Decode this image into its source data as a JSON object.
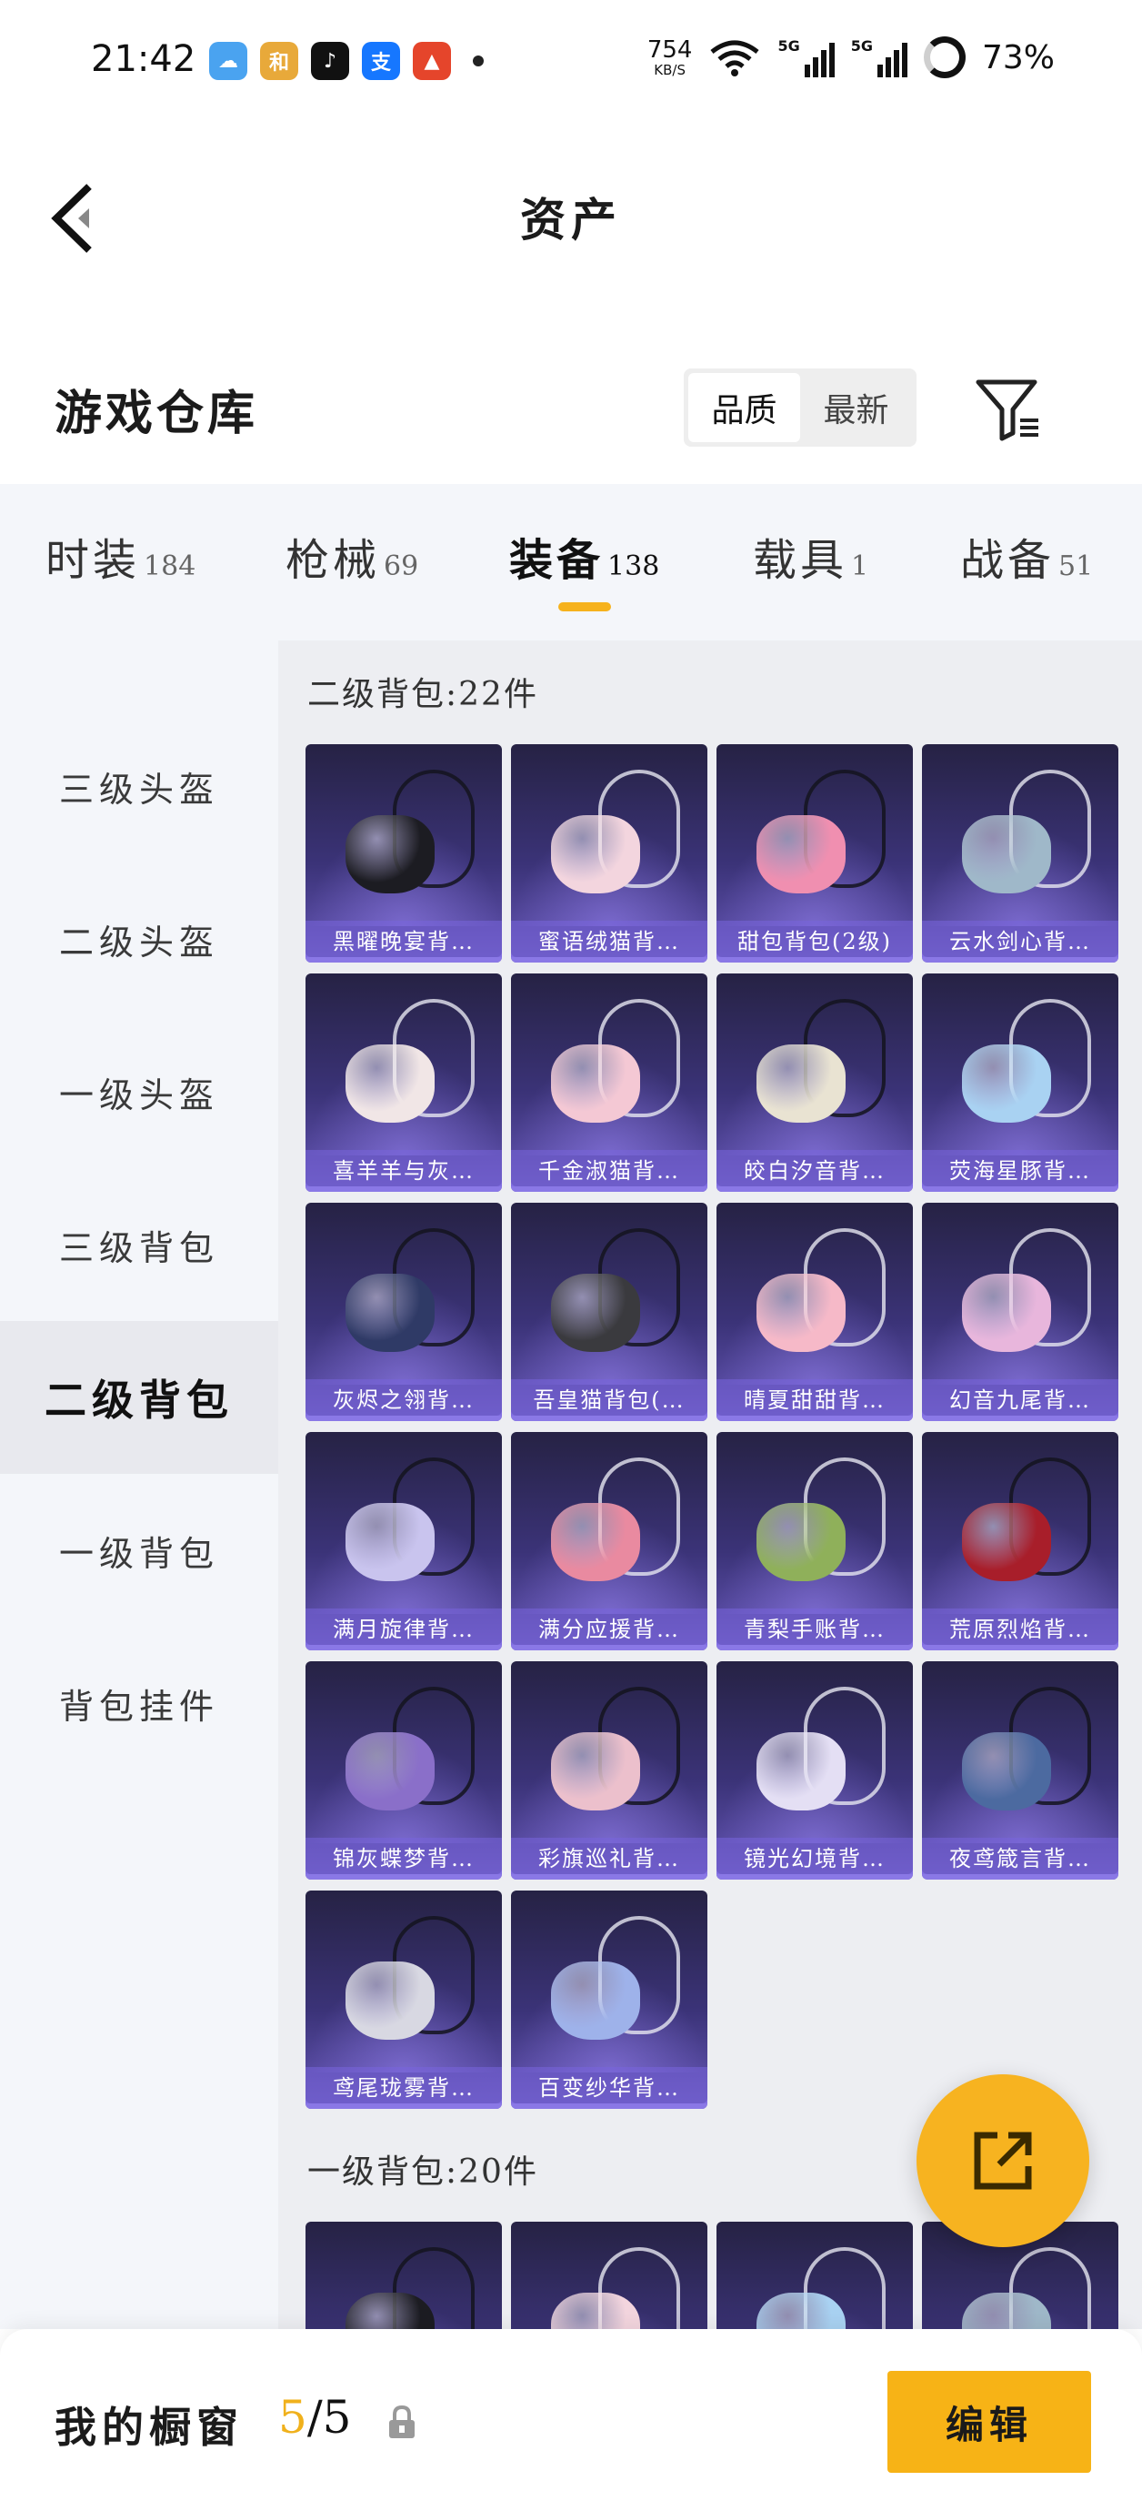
{
  "status_bar": {
    "time": "21:42",
    "apps": [
      {
        "icon": "weather-app-icon",
        "glyph": "☁",
        "color": "#4aa3f0"
      },
      {
        "icon": "game-app-icon",
        "glyph": "和",
        "color": "#e8a93a"
      },
      {
        "icon": "tiktok-app-icon",
        "glyph": "♪",
        "color": "#111111"
      },
      {
        "icon": "alipay-app-icon",
        "glyph": "支",
        "color": "#1677ff"
      },
      {
        "icon": "red-app-icon",
        "glyph": "▲",
        "color": "#e5452b"
      }
    ],
    "net_speed": "754",
    "net_unit": "KB/S",
    "sig1_label": "5G",
    "sig2_label": "5G",
    "battery": "73%"
  },
  "header": {
    "title": "资产"
  },
  "section": {
    "title": "游戏仓库",
    "sort_options": [
      "品质",
      "最新"
    ],
    "active_sort": 0
  },
  "tabs": [
    {
      "label": "时装",
      "count": "184"
    },
    {
      "label": "枪械",
      "count": "69"
    },
    {
      "label": "装备",
      "count": "138"
    },
    {
      "label": "载具",
      "count": "1"
    },
    {
      "label": "战备",
      "count": "51"
    }
  ],
  "active_tab": 2,
  "sidebar": [
    {
      "label": "三级头盔"
    },
    {
      "label": "二级头盔"
    },
    {
      "label": "一级头盔"
    },
    {
      "label": "三级背包"
    },
    {
      "label": "二级背包"
    },
    {
      "label": "一级背包"
    },
    {
      "label": "背包挂件"
    }
  ],
  "active_side": 4,
  "groups": [
    {
      "title": "二级背包:22件",
      "items": [
        {
          "name": "黑曜晚宴背…",
          "color": "#1c1c22",
          "strap": "dark"
        },
        {
          "name": "蜜语绒猫背…",
          "color": "#f3d5de",
          "strap": "light"
        },
        {
          "name": "甜包背包(2级)",
          "color": "#f08fb0",
          "strap": "dark"
        },
        {
          "name": "云水剑心背…",
          "color": "#9fb8c9",
          "strap": "light"
        },
        {
          "name": "喜羊羊与灰…",
          "color": "#f1e6e6",
          "strap": "light"
        },
        {
          "name": "千金淑猫背…",
          "color": "#f4c8d4",
          "strap": "light"
        },
        {
          "name": "皎白汐音背…",
          "color": "#e9e3d2",
          "strap": "dark"
        },
        {
          "name": "荧海星豚背…",
          "color": "#a9d2f2",
          "strap": "light"
        },
        {
          "name": "灰烬之翎背…",
          "color": "#2f3a66",
          "strap": "dark"
        },
        {
          "name": "吾皇猫背包(…",
          "color": "#3a3a3e",
          "strap": "dark"
        },
        {
          "name": "晴夏甜甜背…",
          "color": "#f6b9c8",
          "strap": "light"
        },
        {
          "name": "幻音九尾背…",
          "color": "#e8b6dc",
          "strap": "light"
        },
        {
          "name": "满月旋律背…",
          "color": "#c9c4ee",
          "strap": "dark"
        },
        {
          "name": "满分应援背…",
          "color": "#e98aa0",
          "strap": "light"
        },
        {
          "name": "青梨手账背…",
          "color": "#8fb05a",
          "strap": "light"
        },
        {
          "name": "荒原烈焰背…",
          "color": "#a81e2a",
          "strap": "dark"
        },
        {
          "name": "锦灰蝶梦背…",
          "color": "#8a6fc9",
          "strap": "dark"
        },
        {
          "name": "彩旗巡礼背…",
          "color": "#ecc0cc",
          "strap": "dark"
        },
        {
          "name": "镜光幻境背…",
          "color": "#e4dff4",
          "strap": "light"
        },
        {
          "name": "夜鸢箴言背…",
          "color": "#4c6aa0",
          "strap": "dark"
        },
        {
          "name": "鸢尾珑雾背…",
          "color": "#d8d8e2",
          "strap": "dark"
        },
        {
          "name": "百变纱华背…",
          "color": "#9eb2ea",
          "strap": "light"
        }
      ]
    },
    {
      "title": "一级背包:20件",
      "items": [
        {
          "name": "",
          "color": "#1c1c22",
          "strap": "dark"
        },
        {
          "name": "",
          "color": "#f3d5de",
          "strap": "light"
        },
        {
          "name": "",
          "color": "#a9d2f2",
          "strap": "light"
        },
        {
          "name": "",
          "color": "#9fb8c9",
          "strap": "light"
        }
      ]
    }
  ],
  "bottom": {
    "showcase_label": "我的橱窗",
    "showcase_current": "5",
    "showcase_total": "/5",
    "edit_label": "编辑"
  },
  "accent_color": "#f6b21c"
}
